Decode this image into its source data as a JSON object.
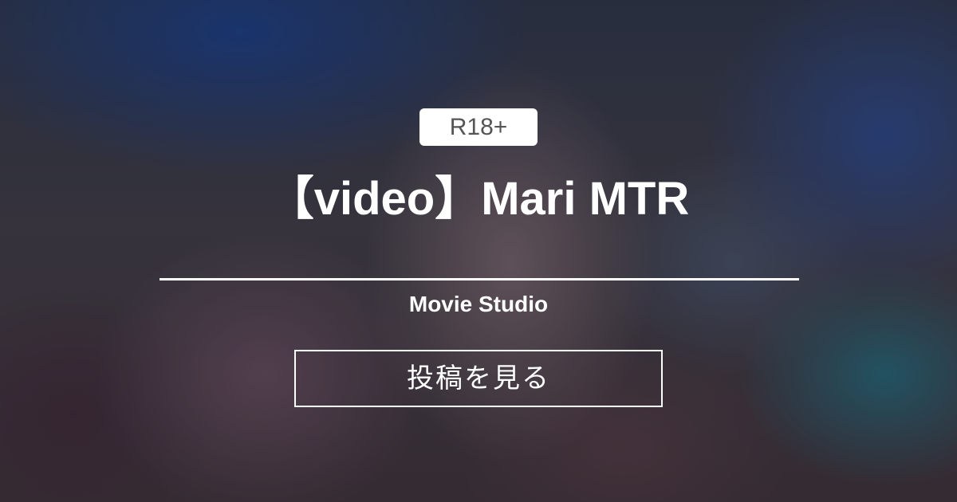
{
  "badge": {
    "label": "R18+"
  },
  "post": {
    "title": "【video】Mari MTR",
    "creator": "Movie Studio"
  },
  "actions": {
    "view_post_label": "投稿を見る"
  },
  "colors": {
    "text": "#ffffff",
    "badge_background": "#ffffff",
    "badge_text": "#555555"
  }
}
